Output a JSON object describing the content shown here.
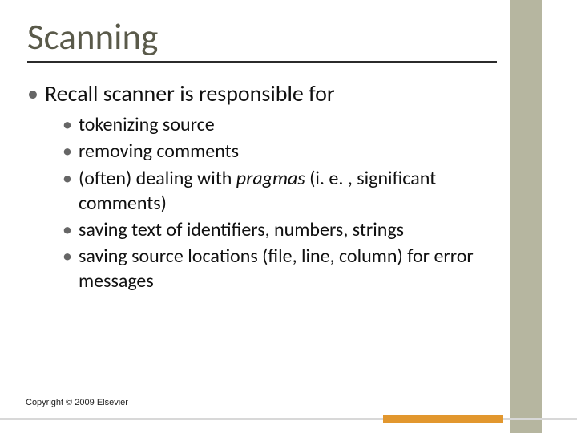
{
  "title": "Scanning",
  "lvl1": "Recall scanner is responsible for",
  "sub": {
    "a": "tokenizing source",
    "b": "removing comments",
    "c_pre": "(often) dealing with ",
    "c_it": "pragmas",
    "c_post": " (i. e. , significant comments)",
    "d": "saving text of identifiers, numbers, strings",
    "e": "saving source locations (file, line, column) for error messages"
  },
  "copyright": "Copyright © 2009 Elsevier"
}
